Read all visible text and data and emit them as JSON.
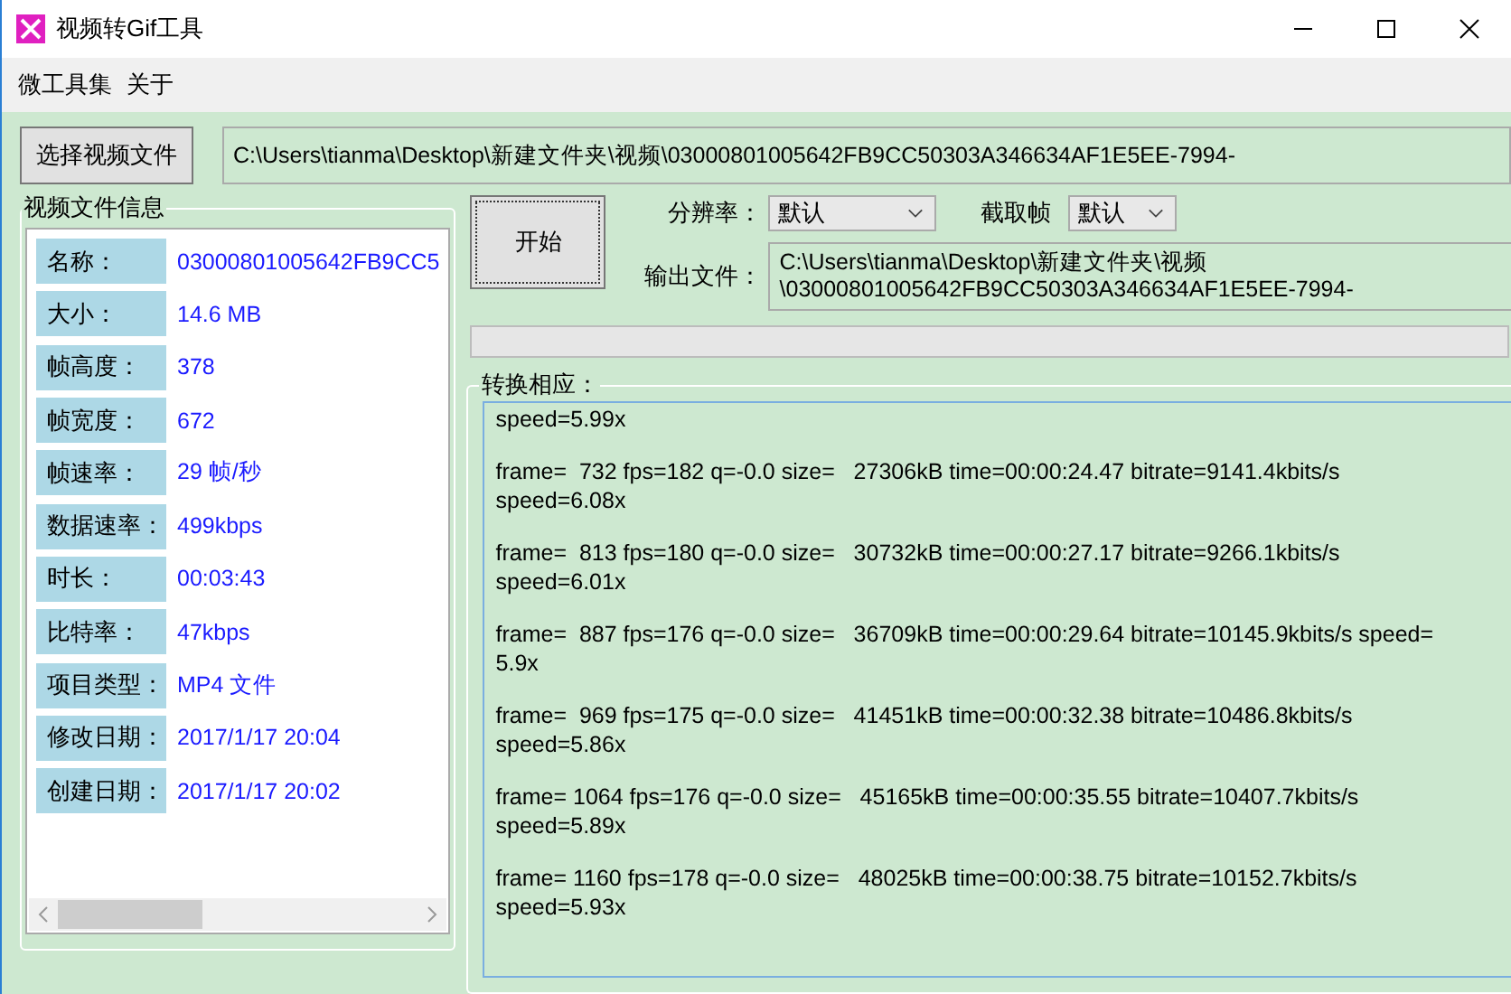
{
  "window": {
    "title": "视频转Gif工具"
  },
  "menu": [
    "微工具集",
    "关于"
  ],
  "file_picker": {
    "button": "选择视频文件",
    "path": "C:\\Users\\tianma\\Desktop\\新建文件夹\\视频\\03000801005642FB9CC50303A346634AF1E5EE-7994-"
  },
  "info_panel": {
    "title": "视频文件信息",
    "rows": [
      {
        "label": "名称：",
        "value": "03000801005642FB9CC5"
      },
      {
        "label": "大小：",
        "value": "14.6 MB"
      },
      {
        "label": "帧高度：",
        "value": "378"
      },
      {
        "label": "帧宽度：",
        "value": "672"
      },
      {
        "label": "帧速率：",
        "value": "29 帧/秒"
      },
      {
        "label": "数据速率：",
        "value": "499kbps"
      },
      {
        "label": "时长：",
        "value": "00:03:43"
      },
      {
        "label": "比特率：",
        "value": "47kbps"
      },
      {
        "label": "项目类型：",
        "value": "MP4 文件"
      },
      {
        "label": "修改日期：",
        "value": "2017/1/17 20:04"
      },
      {
        "label": "创建日期：",
        "value": "2017/1/17 20:02"
      }
    ]
  },
  "controls": {
    "start_button": "开始",
    "resolution": {
      "label": "分辨率：",
      "value": "默认"
    },
    "frame_select": {
      "label": "截取帧",
      "value": "默认"
    },
    "output": {
      "label": "输出文件：",
      "value": "C:\\Users\\tianma\\Desktop\\新建文件夹\\视频\n\\03000801005642FB9CC50303A346634AF1E5EE-7994-"
    }
  },
  "progress": {
    "level": 0
  },
  "log": {
    "title": "转换相应：",
    "lines": [
      "speed=5.99x",
      "frame=  732 fps=182 q=-0.0 size=   27306kB time=00:00:24.47 bitrate=9141.4kbits/s\nspeed=6.08x",
      "frame=  813 fps=180 q=-0.0 size=   30732kB time=00:00:27.17 bitrate=9266.1kbits/s\nspeed=6.01x",
      "frame=  887 fps=176 q=-0.0 size=   36709kB time=00:00:29.64 bitrate=10145.9kbits/s speed=\n5.9x",
      "frame=  969 fps=175 q=-0.0 size=   41451kB time=00:00:32.38 bitrate=10486.8kbits/s\nspeed=5.86x",
      "frame= 1064 fps=176 q=-0.0 size=   45165kB time=00:00:35.55 bitrate=10407.7kbits/s\nspeed=5.89x",
      "frame= 1160 fps=178 q=-0.0 size=   48025kB time=00:00:38.75 bitrate=10152.7kbits/s\nspeed=5.93x"
    ]
  }
}
